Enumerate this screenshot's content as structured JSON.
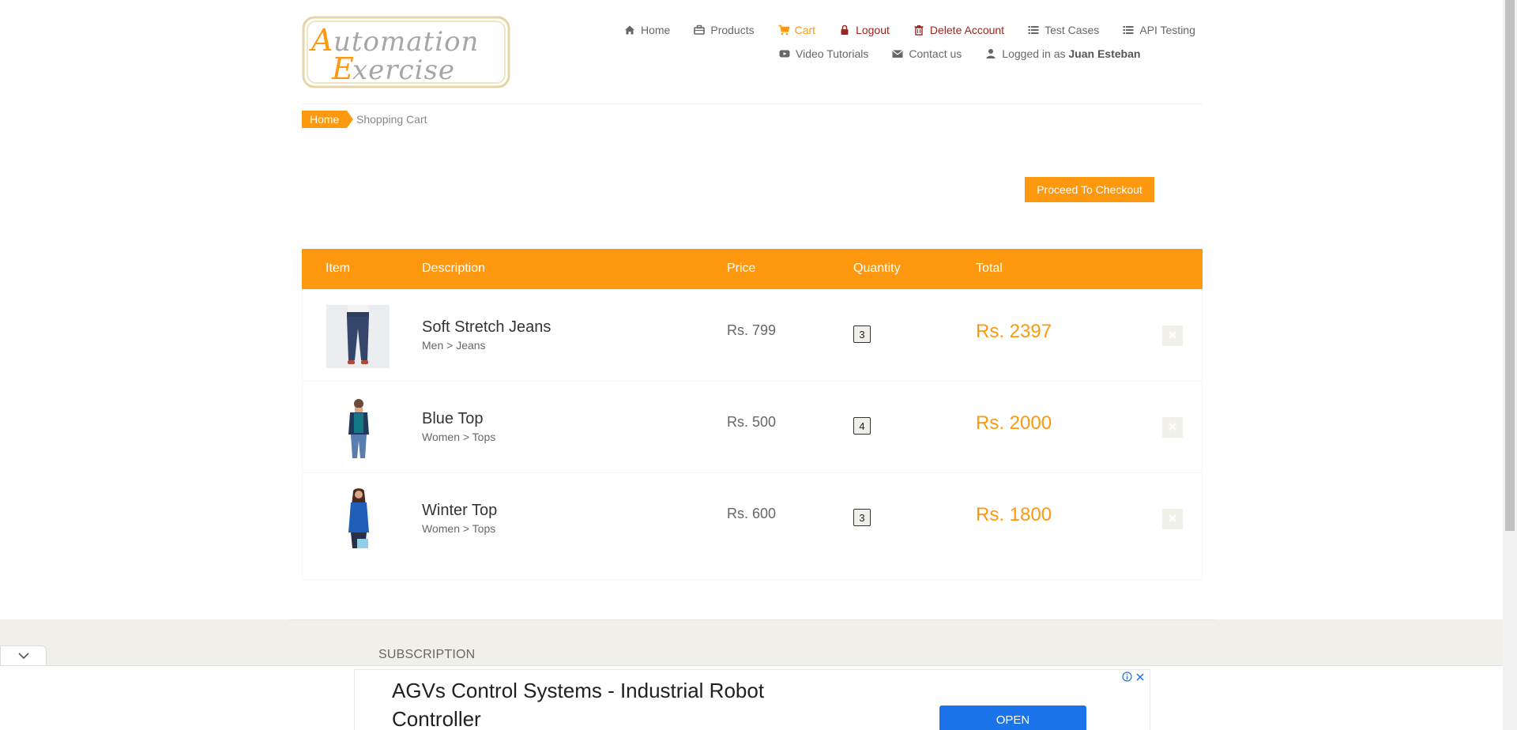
{
  "brand": {
    "logo_line1": "Automation",
    "logo_line2": "Exercise"
  },
  "nav": {
    "row1": [
      {
        "label": "Home",
        "icon": "home-icon"
      },
      {
        "label": "Products",
        "icon": "briefcase-icon"
      },
      {
        "label": "Cart",
        "icon": "cart-icon"
      },
      {
        "label": "Logout",
        "icon": "lock-icon"
      },
      {
        "label": "Delete Account",
        "icon": "trash-icon"
      },
      {
        "label": "Test Cases",
        "icon": "list-icon"
      },
      {
        "label": "API Testing",
        "icon": "list-icon"
      }
    ],
    "row2": [
      {
        "label": "Video Tutorials",
        "icon": "youtube-icon"
      },
      {
        "label": "Contact us",
        "icon": "envelope-icon"
      }
    ],
    "logged_in_prefix": "Logged in as",
    "username": "Juan Esteban"
  },
  "breadcrumb": {
    "home": "Home",
    "current": "Shopping Cart"
  },
  "checkout_button": "Proceed To Checkout",
  "table": {
    "headers": {
      "item": "Item",
      "description": "Description",
      "price": "Price",
      "quantity": "Quantity",
      "total": "Total"
    },
    "rows": [
      {
        "name": "Soft Stretch Jeans",
        "category": "Men > Jeans",
        "price": "Rs. 799",
        "quantity": "3",
        "total": "Rs. 2397"
      },
      {
        "name": "Blue Top",
        "category": "Women > Tops",
        "price": "Rs. 500",
        "quantity": "4",
        "total": "Rs. 2000"
      },
      {
        "name": "Winter Top",
        "category": "Women > Tops",
        "price": "Rs. 600",
        "quantity": "3",
        "total": "Rs. 1800"
      }
    ]
  },
  "footer": {
    "subscription": "SUBSCRIPTION"
  },
  "ad": {
    "title": "AGVs Control Systems - Industrial Robot Controller",
    "cta": "OPEN"
  },
  "colors": {
    "accent": "#FE980F",
    "danger": "#a0241f",
    "ad_button": "#1a73e8"
  }
}
